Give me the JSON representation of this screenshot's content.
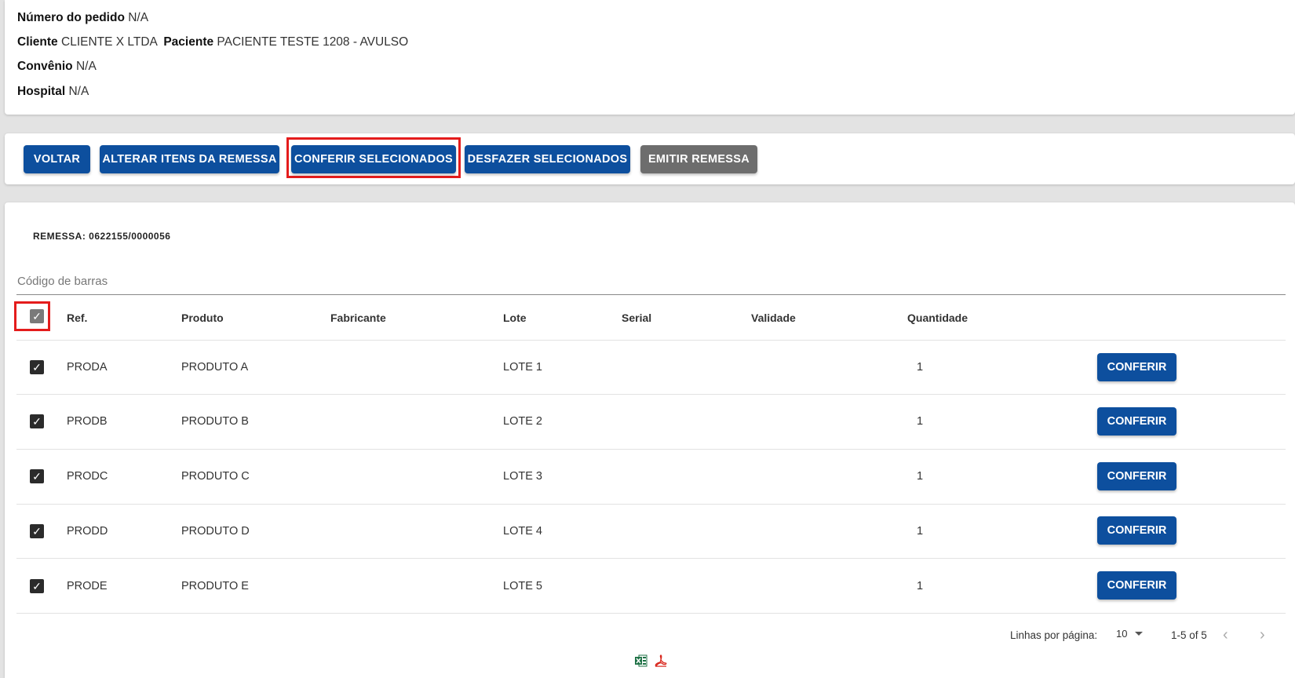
{
  "order": {
    "number_label": "Número do pedido",
    "number_value": "N/A",
    "client_label": "Cliente",
    "client_value": "CLIENTE X LTDA",
    "patient_label": "Paciente",
    "patient_value": "PACIENTE TESTE 1208 - AVULSO",
    "insurance_label": "Convênio",
    "insurance_value": "N/A",
    "hospital_label": "Hospital",
    "hospital_value": "N/A"
  },
  "actions": {
    "back": "VOLTAR",
    "alter_items": "ALTERAR ITENS DA REMESSA",
    "check_selected": "CONFERIR SELECIONADOS",
    "undo_selected": "DESFAZER SELECIONADOS",
    "emit": "EMITIR REMESSA"
  },
  "shipment": {
    "title": "REMESSA: 0622155/0000056",
    "barcode_placeholder": "Código de barras"
  },
  "table": {
    "headers": {
      "ref": "Ref.",
      "product": "Produto",
      "manufacturer": "Fabricante",
      "lot": "Lote",
      "serial": "Serial",
      "validity": "Validade",
      "quantity": "Quantidade"
    },
    "rows": [
      {
        "ref": "PRODA",
        "product": "PRODUTO A",
        "manufacturer": "",
        "lot": "LOTE 1",
        "serial": "",
        "validity": "",
        "quantity": "1",
        "action": "CONFERIR"
      },
      {
        "ref": "PRODB",
        "product": "PRODUTO B",
        "manufacturer": "",
        "lot": "LOTE 2",
        "serial": "",
        "validity": "",
        "quantity": "1",
        "action": "CONFERIR"
      },
      {
        "ref": "PRODC",
        "product": "PRODUTO C",
        "manufacturer": "",
        "lot": "LOTE 3",
        "serial": "",
        "validity": "",
        "quantity": "1",
        "action": "CONFERIR"
      },
      {
        "ref": "PRODD",
        "product": "PRODUTO D",
        "manufacturer": "",
        "lot": "LOTE 4",
        "serial": "",
        "validity": "",
        "quantity": "1",
        "action": "CONFERIR"
      },
      {
        "ref": "PRODE",
        "product": "PRODUTO E",
        "manufacturer": "",
        "lot": "LOTE 5",
        "serial": "",
        "validity": "",
        "quantity": "1",
        "action": "CONFERIR"
      }
    ]
  },
  "pagination": {
    "rows_per_page_label": "Linhas por página:",
    "rows_per_page_value": "10",
    "range": "1-5 of 5",
    "prev_icon": "chevron-left-icon",
    "next_icon": "chevron-right-icon"
  },
  "exports": {
    "excel_icon": "excel-icon",
    "pdf_icon": "pdf-icon"
  },
  "colors": {
    "primary": "#0d4f9e",
    "disabled_button": "#6d6d6d",
    "highlight": "#e41c1c"
  }
}
